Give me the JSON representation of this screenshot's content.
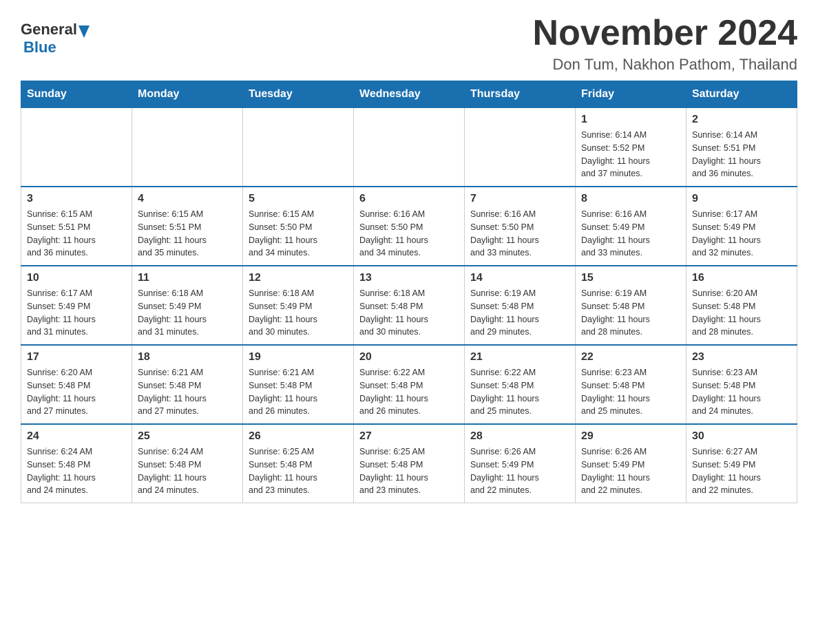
{
  "header": {
    "logo_general": "General",
    "logo_arrow": "▶",
    "logo_blue": "Blue",
    "title": "November 2024",
    "subtitle": "Don Tum, Nakhon Pathom, Thailand"
  },
  "calendar": {
    "headers": [
      "Sunday",
      "Monday",
      "Tuesday",
      "Wednesday",
      "Thursday",
      "Friday",
      "Saturday"
    ],
    "weeks": [
      [
        {
          "day": "",
          "info": ""
        },
        {
          "day": "",
          "info": ""
        },
        {
          "day": "",
          "info": ""
        },
        {
          "day": "",
          "info": ""
        },
        {
          "day": "",
          "info": ""
        },
        {
          "day": "1",
          "info": "Sunrise: 6:14 AM\nSunset: 5:52 PM\nDaylight: 11 hours\nand 37 minutes."
        },
        {
          "day": "2",
          "info": "Sunrise: 6:14 AM\nSunset: 5:51 PM\nDaylight: 11 hours\nand 36 minutes."
        }
      ],
      [
        {
          "day": "3",
          "info": "Sunrise: 6:15 AM\nSunset: 5:51 PM\nDaylight: 11 hours\nand 36 minutes."
        },
        {
          "day": "4",
          "info": "Sunrise: 6:15 AM\nSunset: 5:51 PM\nDaylight: 11 hours\nand 35 minutes."
        },
        {
          "day": "5",
          "info": "Sunrise: 6:15 AM\nSunset: 5:50 PM\nDaylight: 11 hours\nand 34 minutes."
        },
        {
          "day": "6",
          "info": "Sunrise: 6:16 AM\nSunset: 5:50 PM\nDaylight: 11 hours\nand 34 minutes."
        },
        {
          "day": "7",
          "info": "Sunrise: 6:16 AM\nSunset: 5:50 PM\nDaylight: 11 hours\nand 33 minutes."
        },
        {
          "day": "8",
          "info": "Sunrise: 6:16 AM\nSunset: 5:49 PM\nDaylight: 11 hours\nand 33 minutes."
        },
        {
          "day": "9",
          "info": "Sunrise: 6:17 AM\nSunset: 5:49 PM\nDaylight: 11 hours\nand 32 minutes."
        }
      ],
      [
        {
          "day": "10",
          "info": "Sunrise: 6:17 AM\nSunset: 5:49 PM\nDaylight: 11 hours\nand 31 minutes."
        },
        {
          "day": "11",
          "info": "Sunrise: 6:18 AM\nSunset: 5:49 PM\nDaylight: 11 hours\nand 31 minutes."
        },
        {
          "day": "12",
          "info": "Sunrise: 6:18 AM\nSunset: 5:49 PM\nDaylight: 11 hours\nand 30 minutes."
        },
        {
          "day": "13",
          "info": "Sunrise: 6:18 AM\nSunset: 5:48 PM\nDaylight: 11 hours\nand 30 minutes."
        },
        {
          "day": "14",
          "info": "Sunrise: 6:19 AM\nSunset: 5:48 PM\nDaylight: 11 hours\nand 29 minutes."
        },
        {
          "day": "15",
          "info": "Sunrise: 6:19 AM\nSunset: 5:48 PM\nDaylight: 11 hours\nand 28 minutes."
        },
        {
          "day": "16",
          "info": "Sunrise: 6:20 AM\nSunset: 5:48 PM\nDaylight: 11 hours\nand 28 minutes."
        }
      ],
      [
        {
          "day": "17",
          "info": "Sunrise: 6:20 AM\nSunset: 5:48 PM\nDaylight: 11 hours\nand 27 minutes."
        },
        {
          "day": "18",
          "info": "Sunrise: 6:21 AM\nSunset: 5:48 PM\nDaylight: 11 hours\nand 27 minutes."
        },
        {
          "day": "19",
          "info": "Sunrise: 6:21 AM\nSunset: 5:48 PM\nDaylight: 11 hours\nand 26 minutes."
        },
        {
          "day": "20",
          "info": "Sunrise: 6:22 AM\nSunset: 5:48 PM\nDaylight: 11 hours\nand 26 minutes."
        },
        {
          "day": "21",
          "info": "Sunrise: 6:22 AM\nSunset: 5:48 PM\nDaylight: 11 hours\nand 25 minutes."
        },
        {
          "day": "22",
          "info": "Sunrise: 6:23 AM\nSunset: 5:48 PM\nDaylight: 11 hours\nand 25 minutes."
        },
        {
          "day": "23",
          "info": "Sunrise: 6:23 AM\nSunset: 5:48 PM\nDaylight: 11 hours\nand 24 minutes."
        }
      ],
      [
        {
          "day": "24",
          "info": "Sunrise: 6:24 AM\nSunset: 5:48 PM\nDaylight: 11 hours\nand 24 minutes."
        },
        {
          "day": "25",
          "info": "Sunrise: 6:24 AM\nSunset: 5:48 PM\nDaylight: 11 hours\nand 24 minutes."
        },
        {
          "day": "26",
          "info": "Sunrise: 6:25 AM\nSunset: 5:48 PM\nDaylight: 11 hours\nand 23 minutes."
        },
        {
          "day": "27",
          "info": "Sunrise: 6:25 AM\nSunset: 5:48 PM\nDaylight: 11 hours\nand 23 minutes."
        },
        {
          "day": "28",
          "info": "Sunrise: 6:26 AM\nSunset: 5:49 PM\nDaylight: 11 hours\nand 22 minutes."
        },
        {
          "day": "29",
          "info": "Sunrise: 6:26 AM\nSunset: 5:49 PM\nDaylight: 11 hours\nand 22 minutes."
        },
        {
          "day": "30",
          "info": "Sunrise: 6:27 AM\nSunset: 5:49 PM\nDaylight: 11 hours\nand 22 minutes."
        }
      ]
    ]
  }
}
